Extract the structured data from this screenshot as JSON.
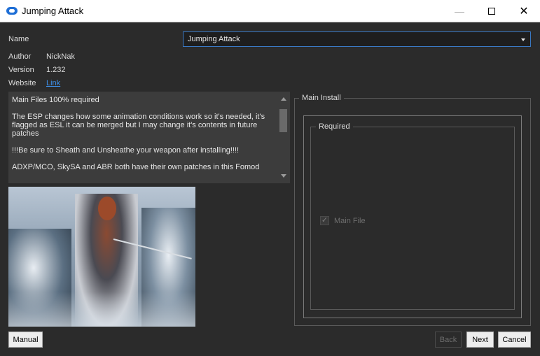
{
  "window": {
    "title": "Jumping Attack",
    "icons": {
      "app": "app-logo-icon",
      "minimize": "minimize-icon",
      "maximize": "maximize-icon",
      "close": "close-icon"
    }
  },
  "info": {
    "name_label": "Name",
    "name_value": "Jumping Attack",
    "author_label": "Author",
    "author_value": "NickNak",
    "version_label": "Version",
    "version_value": "1.232",
    "website_label": "Website",
    "website_link": "Link"
  },
  "description": {
    "paragraphs": [
      "Main Files 100% required",
      "The ESP changes how some animation conditions work so it's needed, it's flagged as ESL it can be merged but I may change it's contents in future patches",
      "!!!Be sure to Sheath and Unsheathe your weapon after installing!!!!",
      "ADXP/MCO, SkySA and ABR both have their own patches in this Fomod"
    ]
  },
  "install": {
    "group_title": "Main Install",
    "subgroup_title": "Required",
    "option_label": "Main File",
    "option_checked": true
  },
  "buttons": {
    "manual": "Manual",
    "back": "Back",
    "next": "Next",
    "cancel": "Cancel"
  },
  "colors": {
    "background": "#2b2b2b",
    "accent": "#3a79c4",
    "link": "#3d8fe8"
  }
}
